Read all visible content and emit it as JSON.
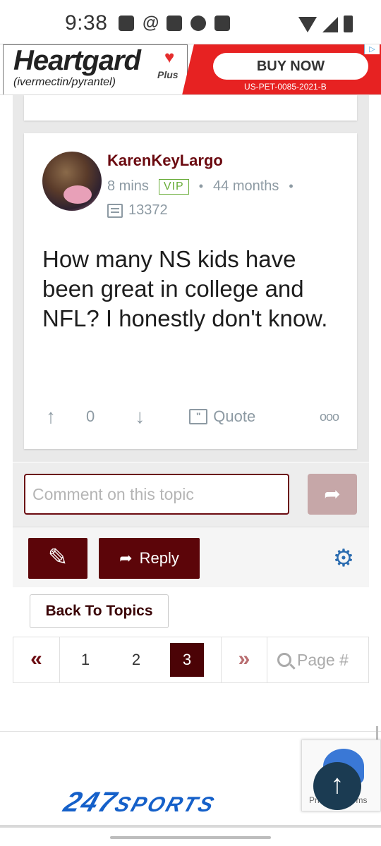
{
  "status_bar": {
    "time": "9:38"
  },
  "ad": {
    "brand": "Heartgard",
    "plus": "Plus",
    "subtitle": "(ivermectin/pyrantel)",
    "cta": "BUY NOW",
    "code": "US-PET-0085-2021-B"
  },
  "post": {
    "username": "KarenKeyLargo",
    "time_ago": "8 mins",
    "badge": "VIP",
    "membership": "44 months",
    "post_count": "13372",
    "body": "How many NS kids have been great in college and NFL? I honestly don't know.",
    "votes": "0",
    "quote_label": "Quote",
    "more_label": "ooo"
  },
  "comment": {
    "placeholder": "Comment on this topic"
  },
  "toolbar": {
    "reply_label": "Reply"
  },
  "back_label": "Back To Topics",
  "pagination": {
    "first": "«",
    "pages": [
      "1",
      "2"
    ],
    "current": "3",
    "last": "»",
    "placeholder": "Page #"
  },
  "footer": {
    "logo_247": "247",
    "logo_sports": "SPORTS",
    "recaptcha": "Privacy - Terms"
  },
  "colors": {
    "brand_maroon": "#5c0509",
    "vip_green": "#6aad3a",
    "meta_gray": "#8d9aa3",
    "gear_blue": "#2b6cb0"
  }
}
